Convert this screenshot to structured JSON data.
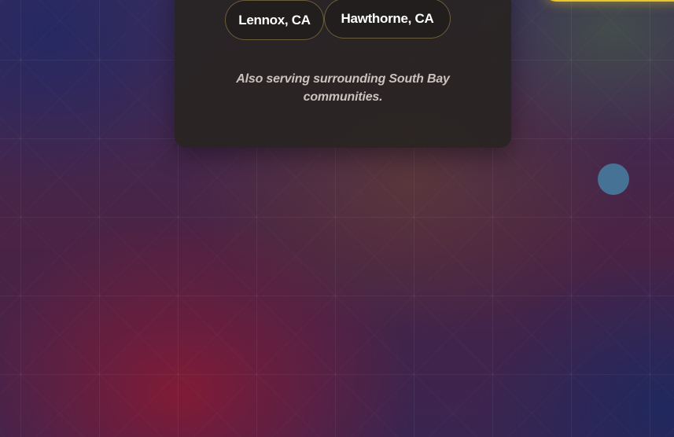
{
  "service_areas": {
    "locations": [
      {
        "label": "Lennox, CA"
      },
      {
        "label": "Hawthorne, CA"
      }
    ],
    "note": "Also serving surrounding South Bay communities."
  },
  "colors": {
    "accent_yellow": "#e8c52a",
    "pill_border": "#c8aa5a",
    "card_bg": "#282422",
    "scroll_dot": "#468caf"
  }
}
